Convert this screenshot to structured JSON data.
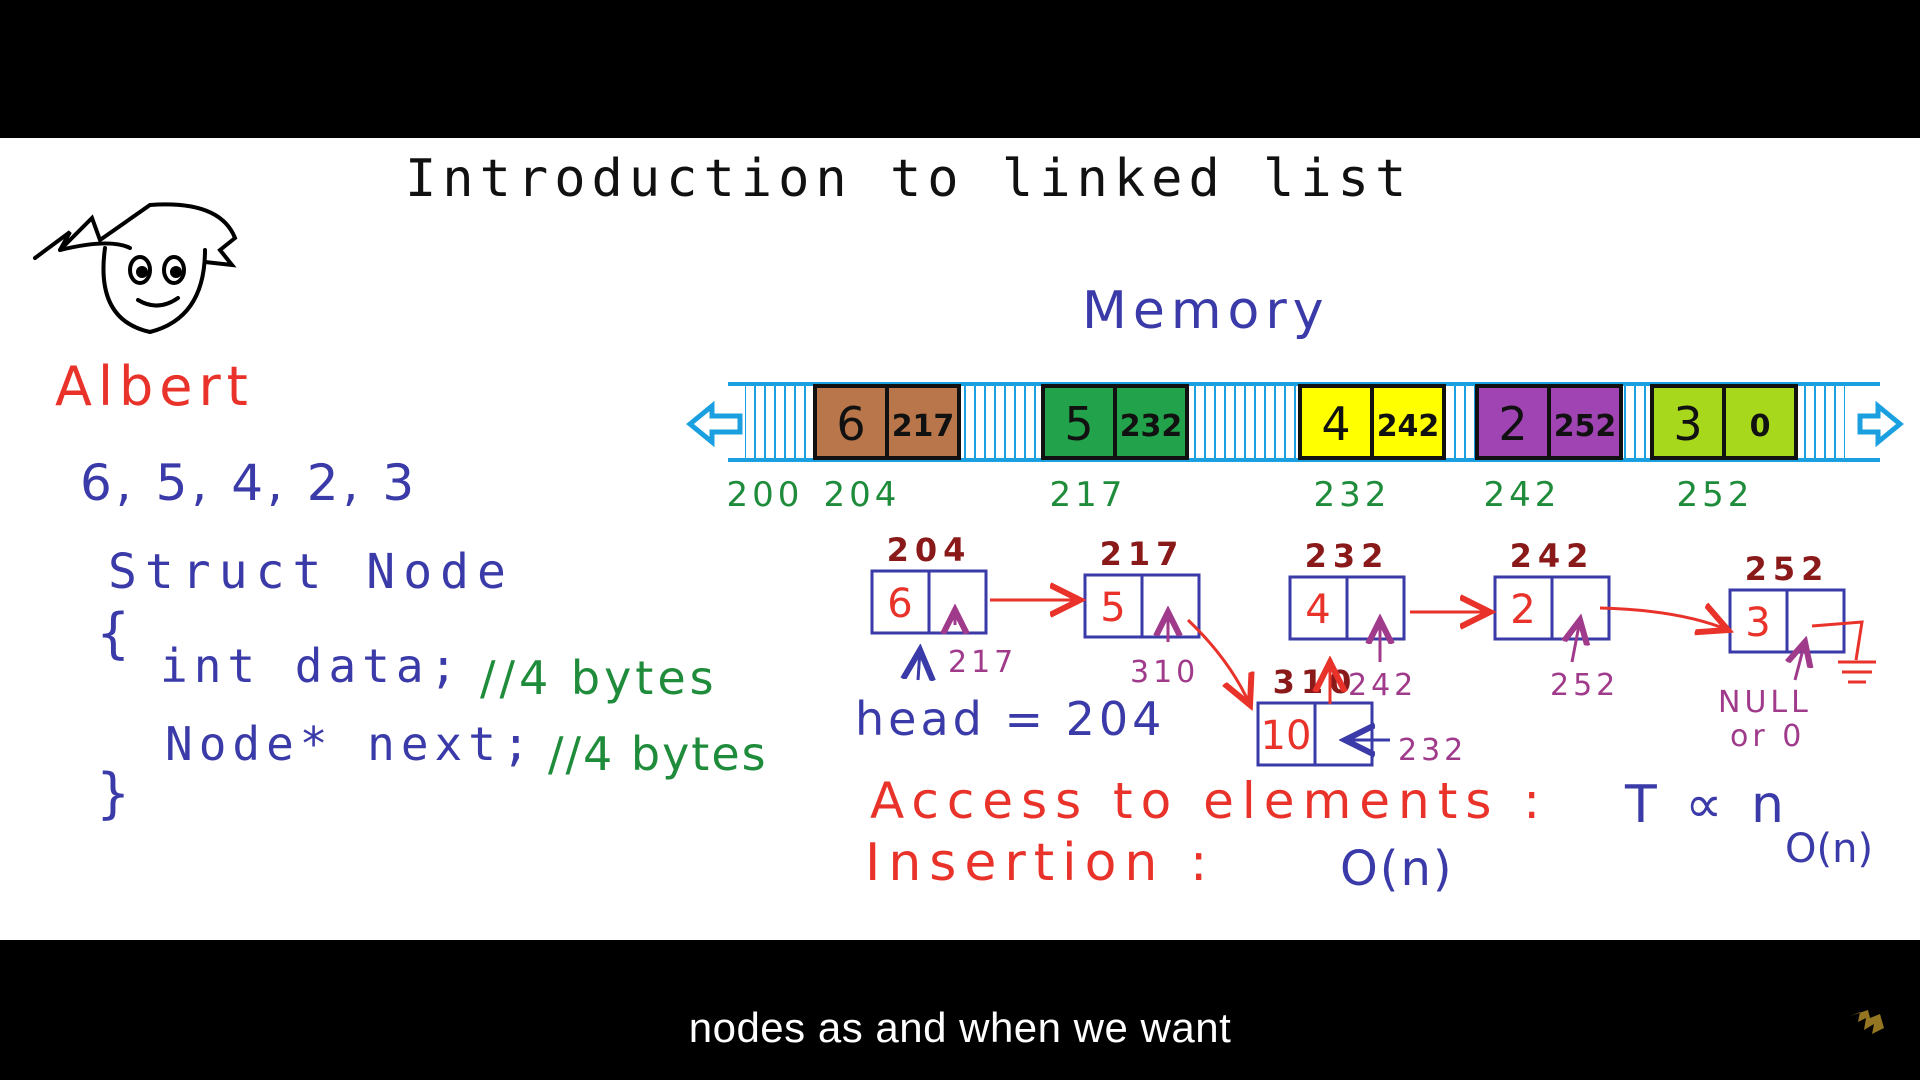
{
  "board": {
    "title": "Introduction to linked list",
    "teacher_name": "Albert",
    "list_values": "6, 5, 4, 2, 3",
    "code": {
      "struct_line": "Struct Node",
      "open_brace": "{",
      "data_decl": "int data;",
      "data_comment": "//4 bytes",
      "next_decl": "Node* next;",
      "next_comment": "//4 bytes",
      "close_brace": "}"
    },
    "memory": {
      "label": "Memory",
      "blocks": [
        {
          "data": "6",
          "next": "217",
          "color": "#b8764a"
        },
        {
          "data": "5",
          "next": "232",
          "color": "#22a24a"
        },
        {
          "data": "4",
          "next": "242",
          "color": "#ffff00"
        },
        {
          "data": "2",
          "next": "252",
          "color": "#a044b4"
        },
        {
          "data": "3",
          "next": "0",
          "color": "#a8d81c"
        }
      ],
      "addresses": [
        "200",
        "204",
        "217",
        "232",
        "242",
        "252"
      ]
    },
    "linked_list": {
      "nodes": [
        {
          "addr": "204",
          "data": "6",
          "ptr_label": "217"
        },
        {
          "addr": "217",
          "data": "5",
          "ptr_label": "310"
        },
        {
          "addr": "232",
          "data": "4",
          "ptr_label": "242"
        },
        {
          "addr": "242",
          "data": "2",
          "ptr_label": "252"
        },
        {
          "addr": "252",
          "data": "3",
          "ptr_label": "NULL or 0"
        }
      ],
      "inserted_node": {
        "addr": "310",
        "data": "10",
        "ptr_label": "232"
      }
    },
    "head": "head = 204",
    "access_label": "Access to elements :",
    "access_value": "T ∝ n",
    "access_bigo": "O(n)",
    "insertion_label": "Insertion :",
    "insertion_value": "O(n)"
  },
  "subtitle": "nodes as and when we want",
  "colors": {
    "red": "#e8322a",
    "blue": "#3a3aa8",
    "green": "#1e8c3a",
    "cyan": "#1aa0e0",
    "dark_red": "#8a1a1a"
  }
}
